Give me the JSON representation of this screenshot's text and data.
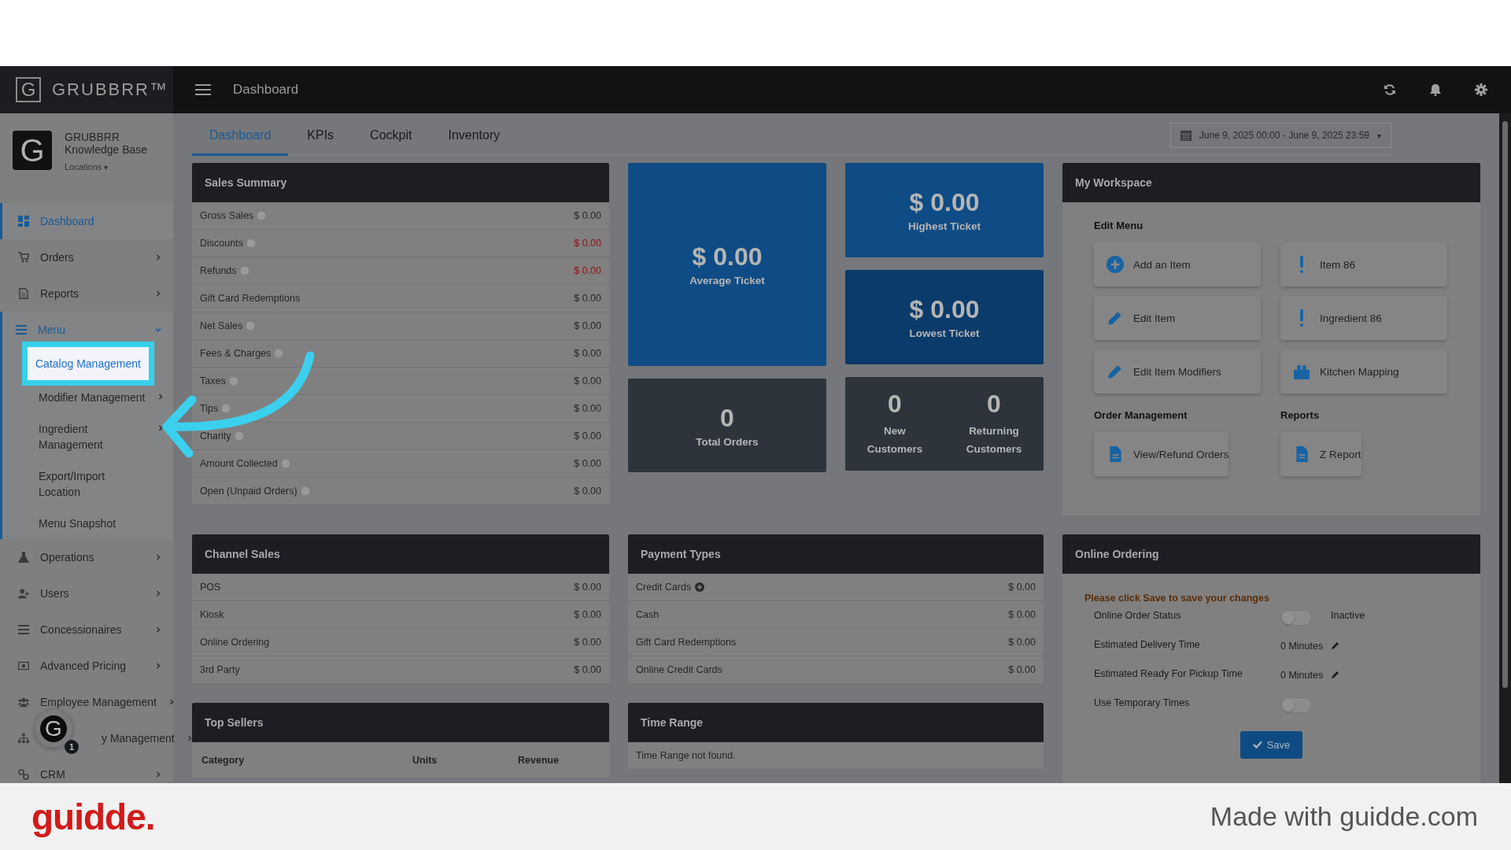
{
  "brand": {
    "logo_letter": "G",
    "name": "GRUBBRR™"
  },
  "topbar": {
    "title": "Dashboard"
  },
  "profile": {
    "avatar_letter": "G",
    "name": "GRUBBRR Knowledge Base",
    "locations": "Locations",
    "caret": "▾"
  },
  "sidebar": {
    "items": [
      {
        "label": "Dashboard",
        "selected": true,
        "has_submenu": false
      },
      {
        "label": "Orders",
        "selected": false,
        "has_submenu": true
      },
      {
        "label": "Reports",
        "selected": false,
        "has_submenu": true
      },
      {
        "label": "Menu",
        "has_submenu": true,
        "expanded": true,
        "children": [
          {
            "label": "Catalog Management",
            "highlighted": true,
            "has_submenu": false
          },
          {
            "label": "Modifier Management",
            "highlighted": false,
            "has_submenu": true
          },
          {
            "label": "Ingredient Management",
            "highlighted": false,
            "has_submenu": true
          },
          {
            "label": "Export/Import Location",
            "highlighted": false,
            "has_submenu": false
          },
          {
            "label": "Menu Snapshot",
            "highlighted": false,
            "has_submenu": false
          }
        ]
      },
      {
        "label": "Operations",
        "selected": false,
        "has_submenu": true
      },
      {
        "label": "Users",
        "selected": false,
        "has_submenu": true
      },
      {
        "label": "Concessionaires",
        "selected": false,
        "has_submenu": true
      },
      {
        "label": "Advanced Pricing",
        "selected": false,
        "has_submenu": true
      },
      {
        "label": "Employee Management",
        "selected": false,
        "has_submenu": true
      },
      {
        "label": "y Management",
        "selected": false,
        "has_submenu": true,
        "covered_by_bubble": true
      },
      {
        "label": "CRM",
        "selected": false,
        "has_submenu": true
      }
    ]
  },
  "tabs": [
    {
      "label": "Dashboard",
      "selected": true
    },
    {
      "label": "KPIs",
      "selected": false
    },
    {
      "label": "Cockpit",
      "selected": false
    },
    {
      "label": "Inventory",
      "selected": false
    }
  ],
  "date_range": {
    "label": "June 9, 2025 00:00 - June 9, 2025 23:59",
    "caret": "▾"
  },
  "sales_summary": {
    "title": "Sales Summary",
    "rows": [
      {
        "label": "Gross Sales",
        "value": "$ 0.00",
        "help": true,
        "negative": false
      },
      {
        "label": "Discounts",
        "value": "$ 0.00",
        "help": true,
        "negative": true
      },
      {
        "label": "Refunds",
        "value": "$ 0.00",
        "help": true,
        "negative": true
      },
      {
        "label": "Gift Card Redemptions",
        "value": "$ 0.00",
        "help": false,
        "negative": false
      },
      {
        "label": "Net Sales",
        "value": "$ 0.00",
        "help": true,
        "negative": false
      },
      {
        "label": "Fees & Charges",
        "value": "$ 0.00",
        "help": true,
        "negative": false
      },
      {
        "label": "Taxes",
        "value": "$ 0.00",
        "help": true,
        "negative": false
      },
      {
        "label": "Tips",
        "value": "$ 0.00",
        "help": true,
        "negative": false
      },
      {
        "label": "Charity",
        "value": "$ 0.00",
        "help": true,
        "negative": false
      },
      {
        "label": "Amount Collected",
        "value": "$ 0.00",
        "help": true,
        "negative": false
      },
      {
        "label": "Open (Unpaid Orders)",
        "value": "$ 0.00",
        "help": true,
        "negative": false
      }
    ]
  },
  "average_ticket": {
    "value": "$ 0.00",
    "label": "Average Ticket"
  },
  "highest_ticket": {
    "value": "$ 0.00",
    "label": "Highest Ticket"
  },
  "lowest_ticket": {
    "value": "$ 0.00",
    "label": "Lowest Ticket"
  },
  "total_orders": {
    "value": "0",
    "label": "Total Orders"
  },
  "customers": [
    {
      "value": "0",
      "label": "New Customers"
    },
    {
      "value": "0",
      "label": "Returning Customers"
    }
  ],
  "workspace": {
    "title": "My Workspace",
    "edit_menu": {
      "title": "Edit Menu",
      "actions": [
        {
          "label": "Add an Item"
        },
        {
          "label": "Item 86"
        },
        {
          "label": "Edit Item"
        },
        {
          "label": "Ingredient 86"
        },
        {
          "label": "Edit Item Modifiers"
        },
        {
          "label": "Kitchen Mapping"
        }
      ]
    },
    "groups": [
      {
        "title": "Order Management",
        "actions": [
          {
            "label": "View/Refund Orders"
          }
        ]
      },
      {
        "title": "Reports",
        "actions": [
          {
            "label": "Z Report"
          }
        ]
      }
    ]
  },
  "channel_sales": {
    "title": "Channel Sales",
    "rows": [
      {
        "label": "POS",
        "value": "$ 0.00"
      },
      {
        "label": "Kiosk",
        "value": "$ 0.00"
      },
      {
        "label": "Online Ordering",
        "value": "$ 0.00"
      },
      {
        "label": "3rd Party",
        "value": "$ 0.00"
      }
    ]
  },
  "payment_types": {
    "title": "Payment Types",
    "rows": [
      {
        "label": "Credit Cards",
        "value": "$ 0.00",
        "expandable": true
      },
      {
        "label": "Cash",
        "value": "$ 0.00",
        "expandable": false
      },
      {
        "label": "Gift Card Redemptions",
        "value": "$ 0.00",
        "expandable": false
      },
      {
        "label": "Online Credit Cards",
        "value": "$ 0.00",
        "expandable": false
      }
    ]
  },
  "top_sellers": {
    "title": "Top Sellers",
    "columns": [
      "Category",
      "Units",
      "Revenue"
    ]
  },
  "time_range": {
    "title": "Time Range",
    "message": "Time Range not found."
  },
  "online_ordering": {
    "title": "Online Ordering",
    "notice": "Please click Save to save your changes",
    "rows": [
      {
        "kind": "toggle",
        "label": "Online Order Status",
        "on": false,
        "status": "Inactive"
      },
      {
        "kind": "value",
        "label": "Estimated Delivery Time",
        "value": "0 Minutes"
      },
      {
        "kind": "value",
        "label": "Estimated Ready For Pickup Time",
        "value": "0 Minutes"
      },
      {
        "kind": "toggle",
        "label": "Use Temporary Times",
        "on": false
      }
    ],
    "save": "Save"
  },
  "guide_bubble": {
    "letter": "G",
    "count": "1"
  },
  "footer": {
    "logo": "guidde.",
    "text": "Made with guidde.com"
  }
}
